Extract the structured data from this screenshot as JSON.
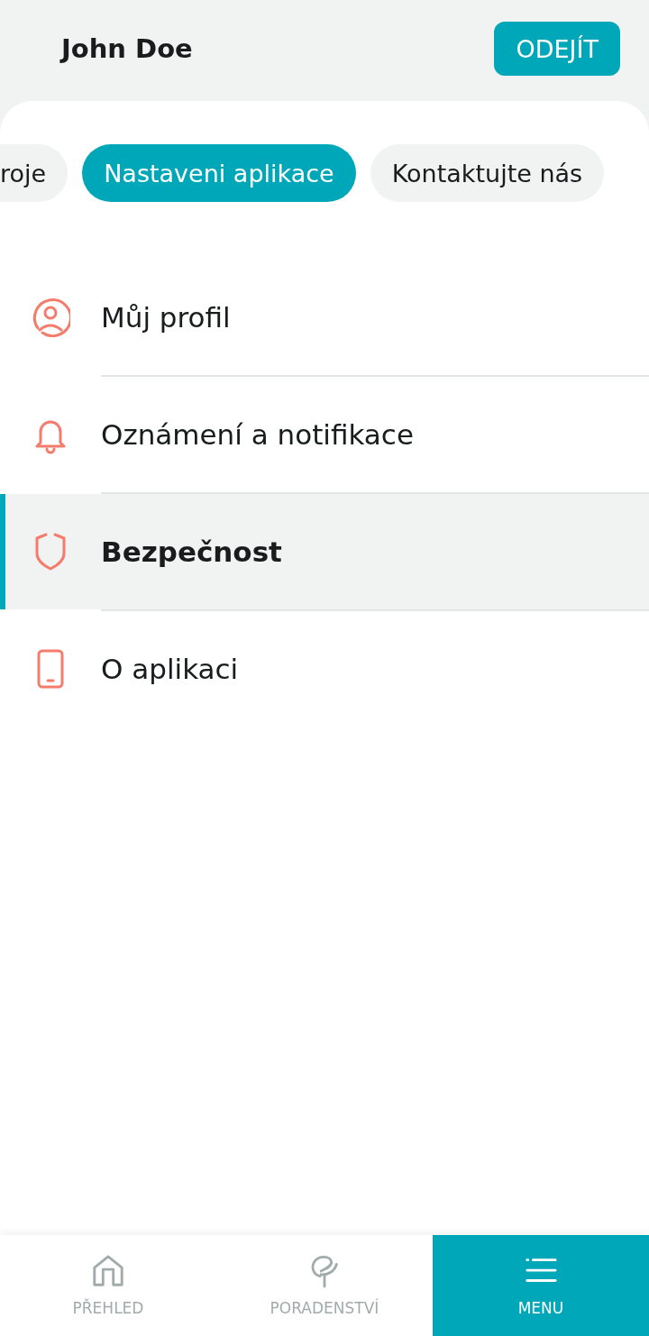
{
  "header": {
    "user_name": "John Doe",
    "logout_button": "ODEJÍT"
  },
  "tabs": [
    {
      "label": "roje",
      "selected": false
    },
    {
      "label": "Nastaveni aplikace",
      "selected": true
    },
    {
      "label": "Kontaktujte nás",
      "selected": false
    }
  ],
  "menu": {
    "items": [
      {
        "kind": "profile",
        "label": "Můj profil",
        "selected": false
      },
      {
        "kind": "notifications",
        "label": "Oznámení a notifikace",
        "selected": false
      },
      {
        "kind": "security",
        "label": "Bezpečnost",
        "selected": true
      },
      {
        "kind": "about",
        "label": "O aplikaci",
        "selected": false
      }
    ]
  },
  "bottom_nav": [
    {
      "kind": "overview",
      "label": "PŘEHLED",
      "selected": false
    },
    {
      "kind": "advice",
      "label": "PORADENSTVÍ",
      "selected": false
    },
    {
      "kind": "menu",
      "label": "MENU",
      "selected": true
    }
  ]
}
